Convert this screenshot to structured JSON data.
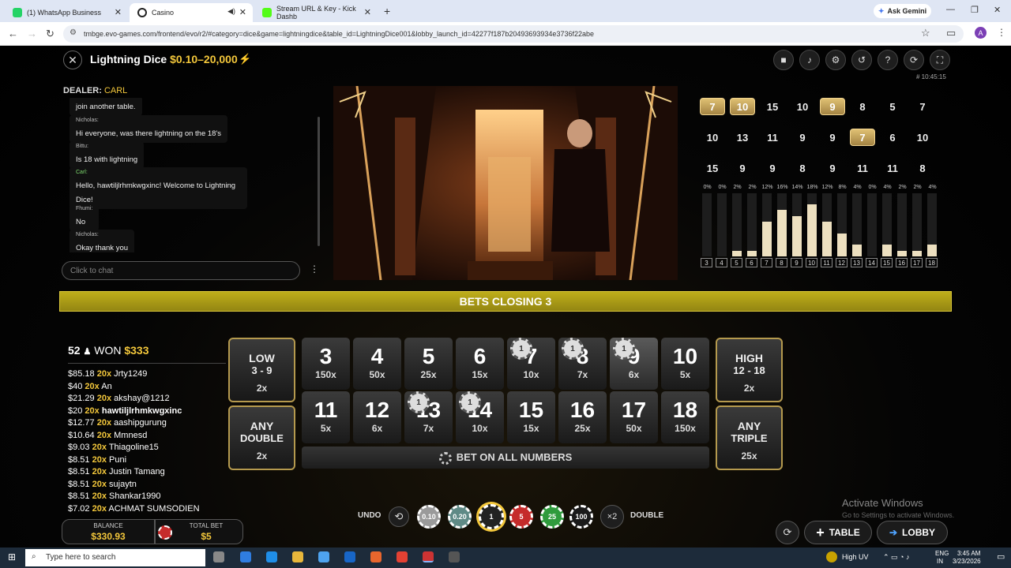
{
  "browser": {
    "tabs": [
      {
        "title": "(1) WhatsApp Business",
        "icon": "whatsapp-icon",
        "color": "#25d366"
      },
      {
        "title": "Casino",
        "icon": "casino-icon",
        "color": "#222222"
      },
      {
        "title": "Stream URL & Key - Kick Dashb",
        "icon": "kick-icon",
        "color": "#53fc18"
      }
    ],
    "gemini_label": "Ask Gemini",
    "url": "tmbge.evo-games.com/frontend/evo/r2/#category=dice&game=lightningdice&table_id=LightningDice001&lobby_launch_id=42277f187b20493693934e3736f22abe",
    "profile_initial": "A"
  },
  "game": {
    "title": "Lightning Dice",
    "limits": "$0.10–20,000",
    "timestamp": "# 10:45:15",
    "dealer_label": "DEALER:",
    "dealer_name": "CARL",
    "chat": [
      {
        "user": "",
        "text": "join another table.",
        "dealer": false
      },
      {
        "user": "Nicholas:",
        "text": "Hi everyone, was there lightning on the 18's",
        "dealer": false
      },
      {
        "user": "Bittu:",
        "text": "Is 18 with lightning",
        "dealer": false
      },
      {
        "user": "Carl:",
        "text": "Hello, hawtiljlrhmkwgxinc! Welcome to Lightning Dice!",
        "dealer": true
      },
      {
        "user": "Fhumi:",
        "text": "No",
        "dealer": false
      },
      {
        "user": "Nicholas:",
        "text": "Okay thank you",
        "dealer": false
      }
    ],
    "chat_placeholder": "Click to chat",
    "history": [
      [
        {
          "v": "7",
          "l": true
        },
        {
          "v": "10",
          "l": true
        },
        {
          "v": "15",
          "l": false
        },
        {
          "v": "10",
          "l": false
        },
        {
          "v": "9",
          "l": true
        },
        {
          "v": "8",
          "l": false
        },
        {
          "v": "5",
          "l": false
        },
        {
          "v": "7",
          "l": false
        }
      ],
      [
        {
          "v": "10",
          "l": false
        },
        {
          "v": "13",
          "l": false
        },
        {
          "v": "11",
          "l": false
        },
        {
          "v": "9",
          "l": false
        },
        {
          "v": "9",
          "l": false
        },
        {
          "v": "7",
          "l": true
        },
        {
          "v": "6",
          "l": false
        },
        {
          "v": "10",
          "l": false
        }
      ],
      [
        {
          "v": "15",
          "l": false
        },
        {
          "v": "9",
          "l": false
        },
        {
          "v": "9",
          "l": false
        },
        {
          "v": "8",
          "l": false
        },
        {
          "v": "9",
          "l": false
        },
        {
          "v": "11",
          "l": false
        },
        {
          "v": "11",
          "l": false
        },
        {
          "v": "8",
          "l": false
        }
      ]
    ],
    "stats": [
      {
        "n": "3",
        "p": "0%",
        "v": 0
      },
      {
        "n": "4",
        "p": "0%",
        "v": 0
      },
      {
        "n": "5",
        "p": "2%",
        "v": 2
      },
      {
        "n": "6",
        "p": "2%",
        "v": 2
      },
      {
        "n": "7",
        "p": "12%",
        "v": 12
      },
      {
        "n": "8",
        "p": "16%",
        "v": 16
      },
      {
        "n": "9",
        "p": "14%",
        "v": 14
      },
      {
        "n": "10",
        "p": "18%",
        "v": 18
      },
      {
        "n": "11",
        "p": "12%",
        "v": 12
      },
      {
        "n": "12",
        "p": "8%",
        "v": 8
      },
      {
        "n": "13",
        "p": "4%",
        "v": 4
      },
      {
        "n": "14",
        "p": "0%",
        "v": 0
      },
      {
        "n": "15",
        "p": "4%",
        "v": 4
      },
      {
        "n": "16",
        "p": "2%",
        "v": 2
      },
      {
        "n": "17",
        "p": "2%",
        "v": 2
      },
      {
        "n": "18",
        "p": "4%",
        "v": 4
      }
    ],
    "closing_text": "BETS CLOSING 3",
    "winners_count": "52",
    "won_label": "WON",
    "won_amount": "$333",
    "winners": [
      {
        "amt": "$85.18",
        "mult": "20x",
        "name": "Jrty1249",
        "hl": false
      },
      {
        "amt": "$40",
        "mult": "20x",
        "name": "An",
        "hl": false
      },
      {
        "amt": "$21.29",
        "mult": "20x",
        "name": "akshay@1212",
        "hl": false
      },
      {
        "amt": "$20",
        "mult": "20x",
        "name": "hawtiljlrhmkwgxinc",
        "hl": true
      },
      {
        "amt": "$12.77",
        "mult": "20x",
        "name": "aashipgurung",
        "hl": false
      },
      {
        "amt": "$10.64",
        "mult": "20x",
        "name": "Mmnesd",
        "hl": false
      },
      {
        "amt": "$9.03",
        "mult": "20x",
        "name": "Thiagoline15",
        "hl": false
      },
      {
        "amt": "$8.51",
        "mult": "20x",
        "name": "Puni",
        "hl": false
      },
      {
        "amt": "$8.51",
        "mult": "20x",
        "name": "Justin Tamang",
        "hl": false
      },
      {
        "amt": "$8.51",
        "mult": "20x",
        "name": "sujaytn",
        "hl": false
      },
      {
        "amt": "$8.51",
        "mult": "20x",
        "name": "Shankar1990",
        "hl": false
      },
      {
        "amt": "$7.02",
        "mult": "20x",
        "name": "ACHMAT SUMSODIEN",
        "hl": false
      }
    ],
    "balance_label": "BALANCE",
    "balance": "$330.93",
    "totalbet_label": "TOTAL BET",
    "totalbet": "$5",
    "board": {
      "low": {
        "t1": "LOW",
        "t2": "3 - 9",
        "odd": "2x"
      },
      "high": {
        "t1": "HIGH",
        "t2": "12 - 18",
        "odd": "2x"
      },
      "any_double": {
        "t1": "ANY",
        "t2": "DOUBLE",
        "odd": "2x"
      },
      "any_triple": {
        "t1": "ANY",
        "t2": "TRIPLE",
        "odd": "25x"
      },
      "row1": [
        {
          "n": "3",
          "o": "150x",
          "chip": ""
        },
        {
          "n": "4",
          "o": "50x",
          "chip": ""
        },
        {
          "n": "5",
          "o": "25x",
          "chip": ""
        },
        {
          "n": "6",
          "o": "15x",
          "chip": ""
        },
        {
          "n": "7",
          "o": "10x",
          "chip": "1"
        },
        {
          "n": "8",
          "o": "7x",
          "chip": "1"
        },
        {
          "n": "9",
          "o": "6x",
          "chip": "1"
        },
        {
          "n": "10",
          "o": "5x",
          "chip": ""
        }
      ],
      "row2": [
        {
          "n": "11",
          "o": "5x",
          "chip": ""
        },
        {
          "n": "12",
          "o": "6x",
          "chip": ""
        },
        {
          "n": "13",
          "o": "7x",
          "chip": "1"
        },
        {
          "n": "14",
          "o": "10x",
          "chip": "1"
        },
        {
          "n": "15",
          "o": "15x",
          "chip": ""
        },
        {
          "n": "16",
          "o": "25x",
          "chip": ""
        },
        {
          "n": "17",
          "o": "50x",
          "chip": ""
        },
        {
          "n": "18",
          "o": "150x",
          "chip": ""
        }
      ],
      "bet_all": "BET ON ALL NUMBERS"
    },
    "undo_label": "UNDO",
    "chips": [
      {
        "v": "0.10",
        "c": "#9a9a9a"
      },
      {
        "v": "0.20",
        "c": "#5f8a86"
      },
      {
        "v": "1",
        "c": "#222222"
      },
      {
        "v": "5",
        "c": "#c52b2b"
      },
      {
        "v": "25",
        "c": "#2f9b3d"
      },
      {
        "v": "100",
        "c": "#1a1a1a"
      }
    ],
    "double_icon": "×2",
    "double_label": "DOUBLE",
    "table_label": "TABLE",
    "lobby_label": "LOBBY"
  },
  "watermark": {
    "line1": "Activate Windows",
    "line2": "Go to Settings to activate Windows."
  },
  "taskbar": {
    "search_placeholder": "Type here to search",
    "weather": "High UV",
    "lang": "ENG",
    "region": "IN",
    "time": "3:45 AM",
    "date": "3/23/2026"
  }
}
